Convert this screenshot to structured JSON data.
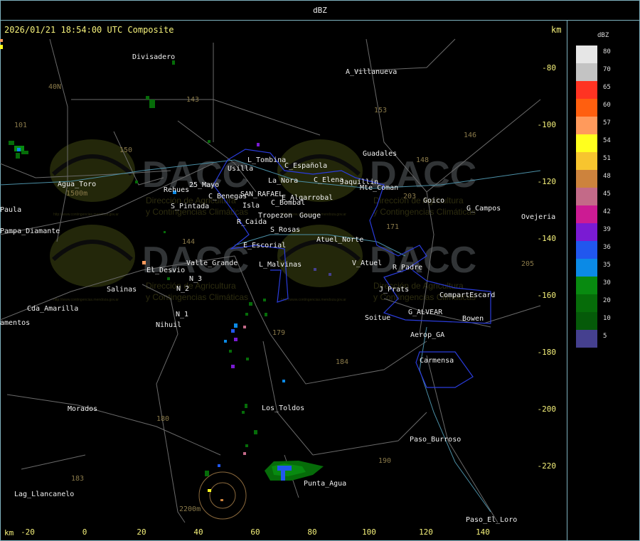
{
  "header": {
    "product": "dBZ",
    "timestamp": "2026/01/21 18:54:00 UTC Composite",
    "unit_top": "km",
    "unit_bottom": "km"
  },
  "axes": {
    "x_ticks": [
      -20,
      0,
      20,
      40,
      60,
      80,
      100,
      120,
      140
    ],
    "y_ticks": [
      -80,
      -100,
      -120,
      -140,
      -160,
      -180,
      -200,
      -220
    ]
  },
  "legend": {
    "title": "dBZ",
    "entries": [
      {
        "label": "80",
        "color": "#e6e6e6"
      },
      {
        "label": "70",
        "color": "#c3c3c3"
      },
      {
        "label": "65",
        "color": "#ff3322"
      },
      {
        "label": "60",
        "color": "#ff5f0f"
      },
      {
        "label": "57",
        "color": "#ff9a5c"
      },
      {
        "label": "54",
        "color": "#ffff1e"
      },
      {
        "label": "51",
        "color": "#f7c52f"
      },
      {
        "label": "48",
        "color": "#cd833d"
      },
      {
        "label": "45",
        "color": "#c36a88"
      },
      {
        "label": "42",
        "color": "#cc1b93"
      },
      {
        "label": "39",
        "color": "#7a1bd3"
      },
      {
        "label": "36",
        "color": "#2157ee"
      },
      {
        "label": "35",
        "color": "#0b8ae6"
      },
      {
        "label": "30",
        "color": "#088a10"
      },
      {
        "label": "20",
        "color": "#066c09"
      },
      {
        "label": "10",
        "color": "#055a09"
      },
      {
        "label": "5",
        "color": "#45408f"
      }
    ]
  },
  "watermark": {
    "logo": "DACC",
    "line1": "Dirección de Agricultura",
    "line2": "y Contingencias Climáticas",
    "url": "http://www.contingencias.mendoza.gov.ar"
  },
  "places": [
    {
      "name": "Divisadero",
      "kind": "white"
    },
    {
      "name": "A_Villanueva",
      "kind": "white"
    },
    {
      "name": "L_Tombina",
      "kind": "white"
    },
    {
      "name": "C_Española",
      "kind": "white"
    },
    {
      "name": "Usilla",
      "kind": "white"
    },
    {
      "name": "La_Nora",
      "kind": "white"
    },
    {
      "name": "C_Elena",
      "kind": "white"
    },
    {
      "name": "Jaquillin",
      "kind": "white"
    },
    {
      "name": "Guadales",
      "kind": "white"
    },
    {
      "name": "Agua_Toro",
      "kind": "white"
    },
    {
      "name": "Rehues",
      "kind": "white"
    },
    {
      "name": "25_Mayo",
      "kind": "white"
    },
    {
      "name": "C_Benegas",
      "kind": "white"
    },
    {
      "name": "SAN_RAFAEL",
      "kind": "white"
    },
    {
      "name": "E_Algarrobal",
      "kind": "white"
    },
    {
      "name": "Mte_Coman",
      "kind": "white"
    },
    {
      "name": "C_Bombal",
      "kind": "white"
    },
    {
      "name": "Goico",
      "kind": "white"
    },
    {
      "name": "G_Campos",
      "kind": "white"
    },
    {
      "name": "Ovejeria",
      "kind": "white"
    },
    {
      "name": "S_Pintada",
      "kind": "white"
    },
    {
      "name": "Isla",
      "kind": "white"
    },
    {
      "name": "Tropezon",
      "kind": "white"
    },
    {
      "name": "Gouge",
      "kind": "white"
    },
    {
      "name": "Paula",
      "kind": "white"
    },
    {
      "name": "Pampa_Diamante",
      "kind": "white"
    },
    {
      "name": "R_Caida",
      "kind": "white"
    },
    {
      "name": "S_Rosas",
      "kind": "white"
    },
    {
      "name": "Atuel_Norte",
      "kind": "white"
    },
    {
      "name": "E_Escorial",
      "kind": "white"
    },
    {
      "name": "El_Desvio",
      "kind": "white"
    },
    {
      "name": "Valle_Grande",
      "kind": "white"
    },
    {
      "name": "L_Malvinas",
      "kind": "white"
    },
    {
      "name": "V_Atuel",
      "kind": "white"
    },
    {
      "name": "R_Padre",
      "kind": "white"
    },
    {
      "name": "N_3",
      "kind": "white"
    },
    {
      "name": "N_2",
      "kind": "white"
    },
    {
      "name": "Salinas",
      "kind": "white"
    },
    {
      "name": "J_Prats",
      "kind": "white"
    },
    {
      "name": "CompartEscard",
      "kind": "white"
    },
    {
      "name": "Cda_Amarilla",
      "kind": "white"
    },
    {
      "name": "N_1",
      "kind": "white"
    },
    {
      "name": "G_ALVEAR",
      "kind": "white"
    },
    {
      "name": "Bowen",
      "kind": "white"
    },
    {
      "name": "Soitue",
      "kind": "white"
    },
    {
      "name": "Nihuil",
      "kind": "white"
    },
    {
      "name": "Aerop_GA",
      "kind": "white"
    },
    {
      "name": "Carmensa",
      "kind": "white"
    },
    {
      "name": "Morados",
      "kind": "white"
    },
    {
      "name": "Los_Toldos",
      "kind": "white"
    },
    {
      "name": "Paso_Burroso",
      "kind": "white"
    },
    {
      "name": "Punta_Agua",
      "kind": "white"
    },
    {
      "name": "Lag_Llancanelo",
      "kind": "white"
    },
    {
      "name": "Paso_El_Loro",
      "kind": "white"
    },
    {
      "name": "amentos",
      "kind": "white"
    },
    {
      "name": "40N",
      "kind": "route"
    },
    {
      "name": "101",
      "kind": "route"
    },
    {
      "name": "143",
      "kind": "route"
    },
    {
      "name": "153",
      "kind": "route"
    },
    {
      "name": "150",
      "kind": "route"
    },
    {
      "name": "146",
      "kind": "route"
    },
    {
      "name": "148",
      "kind": "route"
    },
    {
      "name": "203",
      "kind": "route"
    },
    {
      "name": "171",
      "kind": "route"
    },
    {
      "name": "144",
      "kind": "route"
    },
    {
      "name": "205",
      "kind": "route"
    },
    {
      "name": "179",
      "kind": "route"
    },
    {
      "name": "184",
      "kind": "route"
    },
    {
      "name": "180",
      "kind": "route"
    },
    {
      "name": "183",
      "kind": "route"
    },
    {
      "name": "190",
      "kind": "route"
    },
    {
      "name": "1500m",
      "kind": "route"
    },
    {
      "name": "2200m",
      "kind": "route"
    }
  ]
}
